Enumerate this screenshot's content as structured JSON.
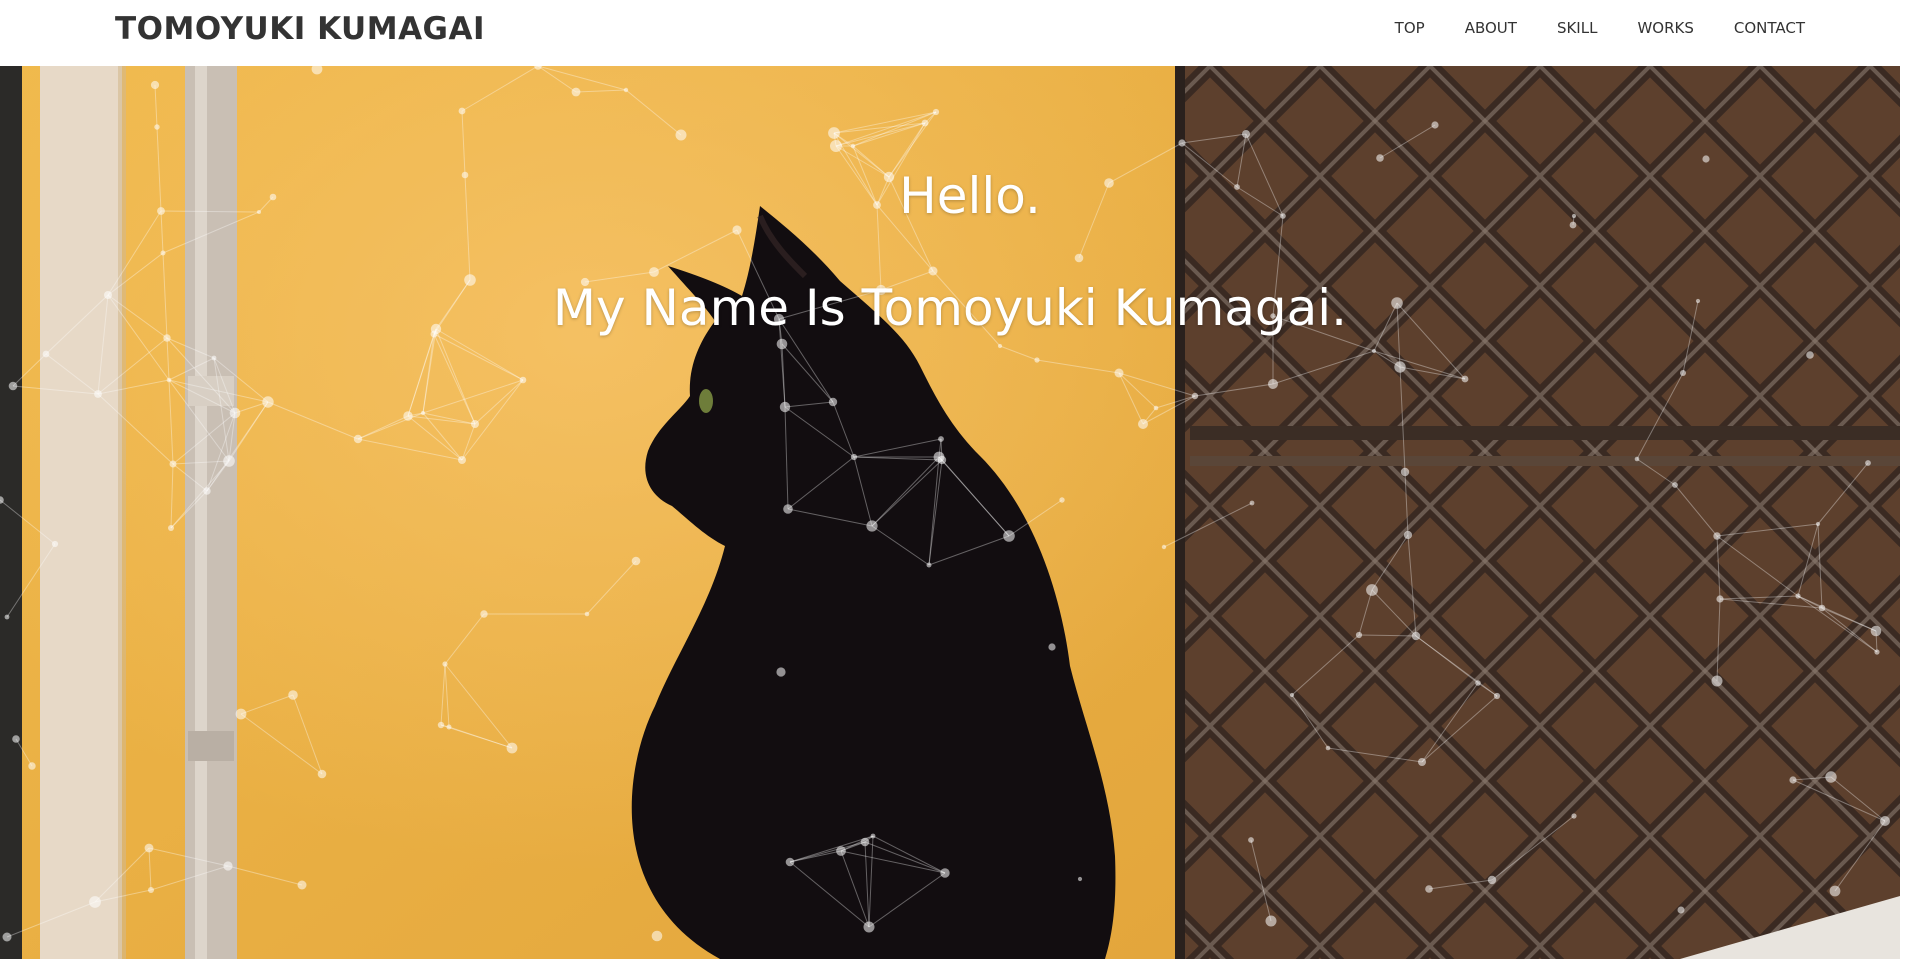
{
  "header": {
    "logo": "TOMOYUKI KUMAGAI",
    "nav": [
      {
        "label": "TOP"
      },
      {
        "label": "ABOUT"
      },
      {
        "label": "SKILL"
      },
      {
        "label": "WORKS"
      },
      {
        "label": "CONTACT"
      }
    ]
  },
  "hero": {
    "greeting": "Hello.",
    "intro": "My Name Is Tomoyuki Kumagai."
  },
  "colors": {
    "wall": "#e9b145",
    "header_bg": "#ffffff",
    "text_dark": "#333333",
    "hero_text": "#ffffff"
  }
}
